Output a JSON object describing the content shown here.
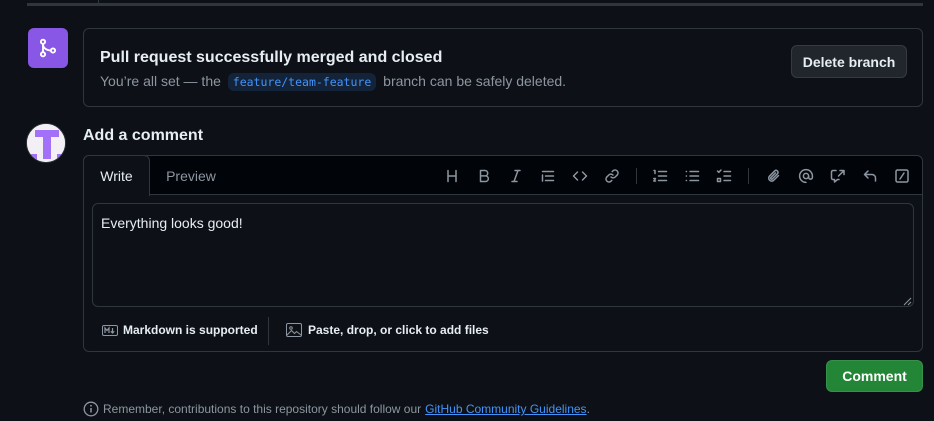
{
  "merged": {
    "title": "Pull request successfully merged and closed",
    "desc_prefix": "You’re all set — the",
    "branch": "feature/team-feature",
    "desc_suffix": "branch can be safely deleted.",
    "delete_label": "Delete branch"
  },
  "comment": {
    "heading": "Add a comment",
    "tabs": {
      "write": "Write",
      "preview": "Preview"
    },
    "toolbar": [
      "heading-icon",
      "bold-icon",
      "italic-icon",
      "quote-icon",
      "code-icon",
      "link-icon",
      "ordered-list-icon",
      "unordered-list-icon",
      "task-list-icon",
      "attach-icon",
      "mention-icon",
      "cross-reference-icon",
      "reply-icon",
      "slash-command-icon"
    ],
    "body": "Everything looks good!",
    "markdown_hint": "Markdown is supported",
    "attach_hint": "Paste, drop, or click to add files",
    "submit_label": "Comment"
  },
  "guidelines": {
    "prefix": "Remember, contributions to this repository should follow our",
    "link": "GitHub Community Guidelines",
    "suffix": "."
  },
  "colors": {
    "background": "#0d1117",
    "merged_purple": "#8957e5",
    "primary_green": "#238636",
    "link_blue": "#4493f8",
    "muted_text": "#8d96a0",
    "border": "#30363d"
  }
}
